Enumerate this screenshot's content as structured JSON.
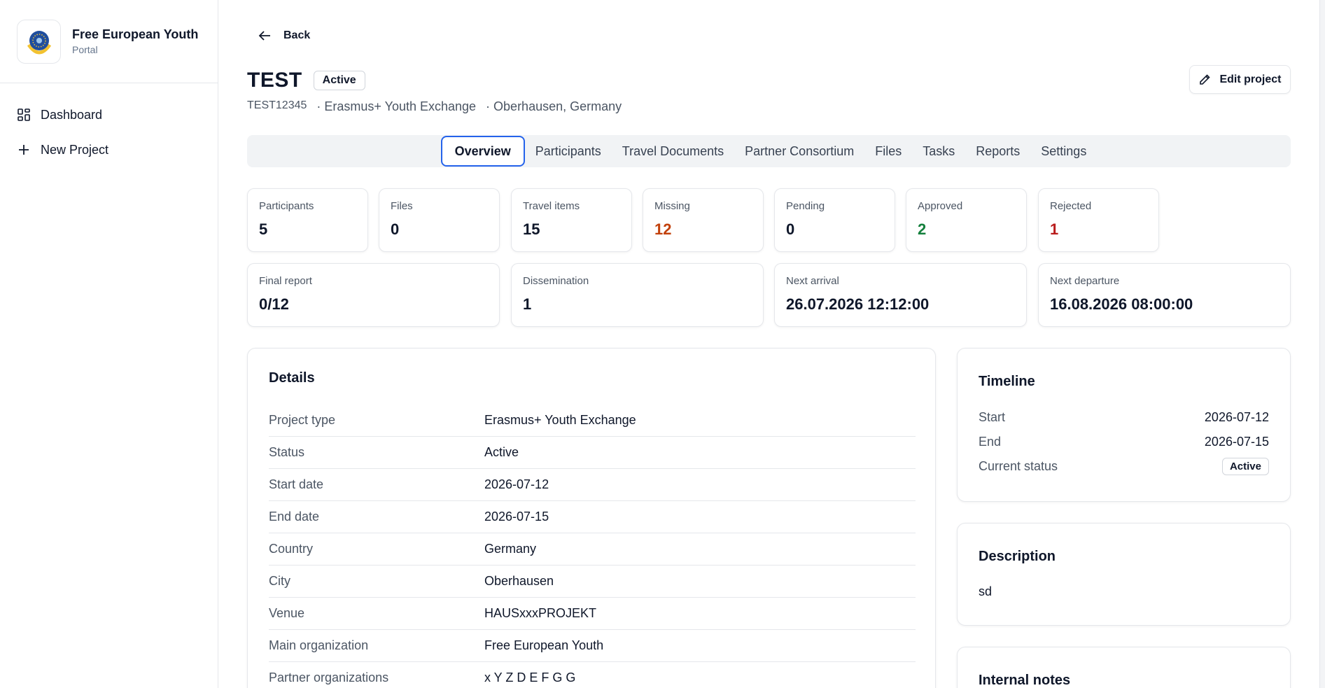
{
  "brand": {
    "title": "Free European Youth",
    "subtitle": "Portal"
  },
  "nav": [
    {
      "label": "Dashboard",
      "icon": "dashboard-icon"
    },
    {
      "label": "New Project",
      "icon": "plus-icon"
    }
  ],
  "back_label": "Back",
  "project": {
    "title": "TEST",
    "status": "Active",
    "code": "TEST12345",
    "type": "· Erasmus+ Youth Exchange",
    "location": "· Oberhausen, Germany"
  },
  "edit_label": "Edit project",
  "tabs": [
    "Overview",
    "Participants",
    "Travel Documents",
    "Partner Consortium",
    "Files",
    "Tasks",
    "Reports",
    "Settings"
  ],
  "stats_row1": [
    {
      "label": "Participants",
      "value": "5",
      "color": "#0f172a"
    },
    {
      "label": "Files",
      "value": "0",
      "color": "#0f172a"
    },
    {
      "label": "Travel items",
      "value": "15",
      "color": "#0f172a"
    },
    {
      "label": "Missing",
      "value": "12",
      "color": "#c2410c"
    },
    {
      "label": "Pending",
      "value": "0",
      "color": "#0f172a"
    },
    {
      "label": "Approved",
      "value": "2",
      "color": "#15803d"
    },
    {
      "label": "Rejected",
      "value": "1",
      "color": "#b91c1c"
    }
  ],
  "stats_row2": [
    {
      "label": "Final report",
      "value": "0/12"
    },
    {
      "label": "Dissemination",
      "value": "1"
    },
    {
      "label": "Next arrival",
      "value": "26.07.2026 12:12:00"
    },
    {
      "label": "Next departure",
      "value": "16.08.2026 08:00:00"
    }
  ],
  "details": {
    "title": "Details",
    "rows": [
      {
        "key": "Project type",
        "value": "Erasmus+ Youth Exchange"
      },
      {
        "key": "Status",
        "value": "Active"
      },
      {
        "key": "Start date",
        "value": "2026-07-12"
      },
      {
        "key": "End date",
        "value": "2026-07-15"
      },
      {
        "key": "Country",
        "value": "Germany"
      },
      {
        "key": "City",
        "value": "Oberhausen"
      },
      {
        "key": "Venue",
        "value": "HAUSxxxPROJEKT"
      },
      {
        "key": "Main organization",
        "value": "Free European Youth"
      },
      {
        "key": "Partner organizations",
        "value": "x Y Z D E F G G"
      }
    ]
  },
  "timeline": {
    "title": "Timeline",
    "start_label": "Start",
    "start_value": "2026-07-12",
    "end_label": "End",
    "end_value": "2026-07-15",
    "status_label": "Current status",
    "status_value": "Active"
  },
  "description": {
    "title": "Description",
    "text": "sd"
  },
  "notes": {
    "title": "Internal notes"
  }
}
